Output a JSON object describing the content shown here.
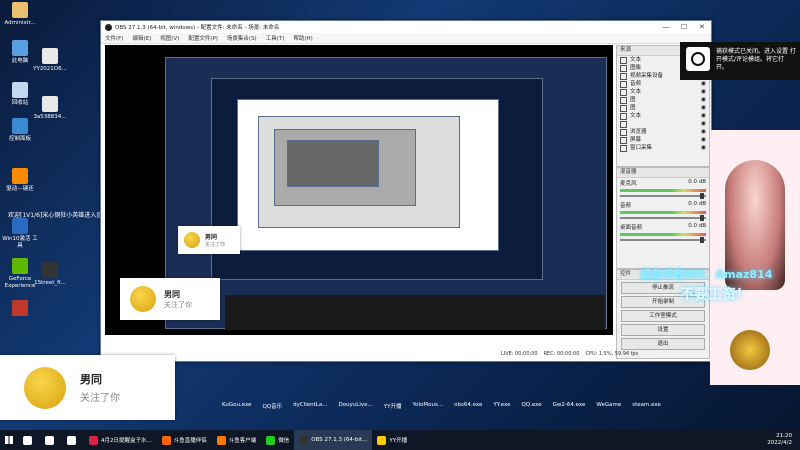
{
  "desktop": {
    "icons": [
      {
        "label": "Administr...",
        "color": "#e8c070"
      },
      {
        "label": "此电脑",
        "color": "#5aa0e0"
      },
      {
        "label": "回收站",
        "color": "#c0d8f0"
      },
      {
        "label": "控制面板",
        "color": "#3a8ad0"
      },
      {
        "label": "驱动—键还",
        "color": "#ff8a00"
      },
      {
        "label": "Win10激活 工具",
        "color": "#2a6ac0"
      },
      {
        "label": "GeForce Experience",
        "color": "#5fb800"
      },
      {
        "label": "",
        "color": "#c0392b"
      }
    ],
    "icons2": [
      {
        "label": "YY2021O6...",
        "color": "#e8e8e8"
      },
      {
        "label": "3a538834...",
        "color": "#e8e8e8"
      },
      {
        "label": "1Street_fi...",
        "color": "#333"
      }
    ],
    "welcome_text": "欢迎[1V1/6]宋心钢狂小英雄进入直播间"
  },
  "obs": {
    "title": "OBS 27.1.3 (64-bit, windows) - 配置文件: 未命名 - 场景: 未命名",
    "menu": [
      "文件(F)",
      "编辑(E)",
      "视图(V)",
      "配置文件(P)",
      "场景集合(S)",
      "工具(T)",
      "帮助(H)"
    ],
    "controls": [
      "—",
      "☐",
      "✕"
    ],
    "sources_title": "来源",
    "sources": [
      "文本",
      "图像",
      "视频采集设备",
      "音频",
      "文本",
      "图",
      "图",
      "文本",
      "",
      "浏览器",
      "屏幕",
      "窗口采集"
    ],
    "mixer_title": "混音器",
    "mixer": [
      {
        "name": "麦克风",
        "val": "0.0 dB"
      },
      {
        "name": "音频",
        "val": "0.0 dB"
      },
      {
        "name": "桌面音频",
        "val": "0.0 dB"
      }
    ],
    "controls_title": "控件",
    "control_buttons": [
      "停止推流",
      "开始录制",
      "工作室模式",
      "设置",
      "退出"
    ],
    "status": {
      "live": "LIVE: 00:00:00",
      "rec": "REC: 00:00:00",
      "cpu": "CPU: 1.5%, 59.94 fps"
    }
  },
  "toast": {
    "text": "捕获模式已关闭。进入设置 打开模式/评论模组。将它打开。"
  },
  "follows": [
    {
      "name": "男同",
      "sub": "关注了你"
    },
    {
      "name": "男同",
      "sub": "关注了你"
    },
    {
      "name": "男同",
      "sub": "关注了你"
    }
  ],
  "neon": {
    "t1": "紧急呼救WX：",
    "t2": "Amaz814",
    "t3": "不要工资！"
  },
  "bottom_apps": [
    "KuGou.exe",
    "QQ音乐",
    "dyClientLa...",
    "DouyuLive...",
    "YY开播",
    "YoloMous...",
    "obs64.exe",
    "YY.exe",
    "QQ.exe",
    "Gw2-64.exe",
    "WeGame",
    "steam.exe"
  ],
  "taskbar": {
    "items": [
      {
        "label": "",
        "color": "#fff"
      },
      {
        "label": "",
        "color": "#fff"
      },
      {
        "label": "",
        "color": "#fff"
      },
      {
        "label": "4月2日提醒盒子水...",
        "color": "#d24"
      },
      {
        "label": "斗鱼直播伴侣",
        "color": "#f60"
      },
      {
        "label": "斗鱼客户端",
        "color": "#f70"
      },
      {
        "label": "微信",
        "color": "#2c2"
      },
      {
        "label": "OBS 27.1.3 (64-bit...",
        "color": "#333"
      },
      {
        "label": "YY开播",
        "color": "#fc0"
      }
    ],
    "time": "21:20",
    "date": "2022/4/2"
  }
}
